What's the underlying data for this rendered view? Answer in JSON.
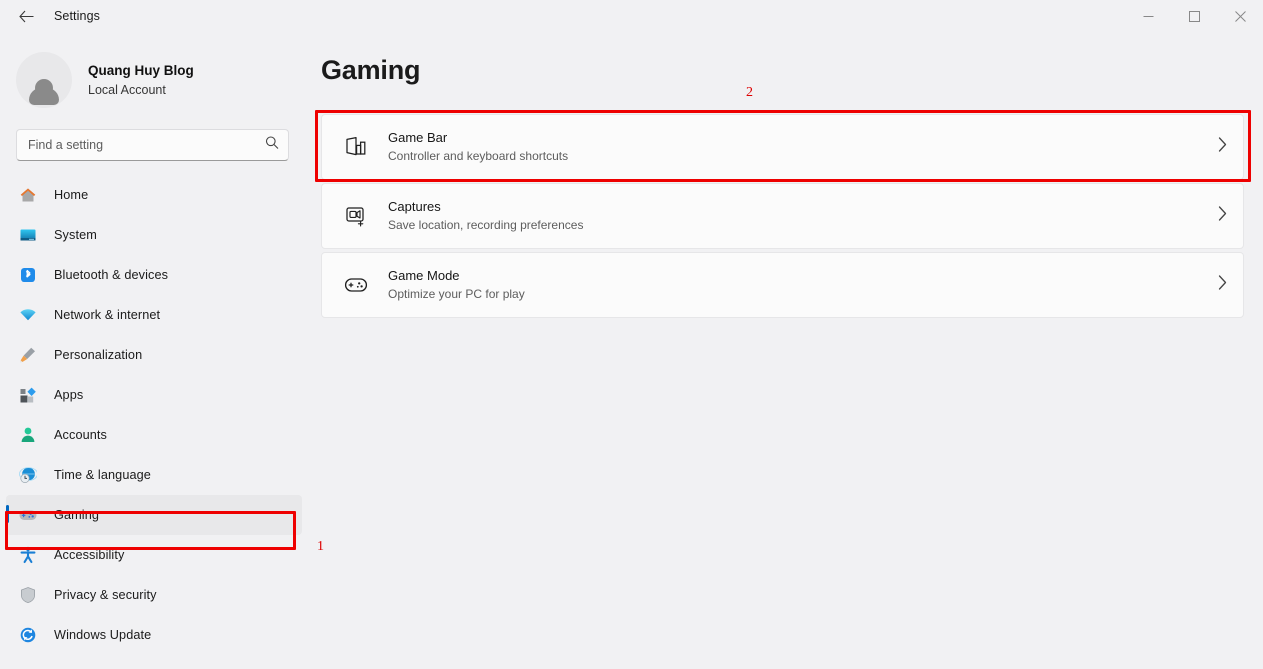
{
  "window": {
    "app_title": "Settings",
    "back_icon": "back-arrow-icon",
    "controls": {
      "minimize": "minimize-icon",
      "maximize": "maximize-icon",
      "close": "close-icon"
    }
  },
  "account": {
    "name": "Quang Huy Blog",
    "type": "Local Account",
    "avatar_icon": "person-avatar-icon"
  },
  "search": {
    "placeholder": "Find a setting",
    "icon": "search-icon"
  },
  "sidebar": {
    "items": [
      {
        "label": "Home",
        "icon": "home-icon",
        "selected": false
      },
      {
        "label": "System",
        "icon": "system-icon",
        "selected": false
      },
      {
        "label": "Bluetooth & devices",
        "icon": "bluetooth-icon",
        "selected": false
      },
      {
        "label": "Network & internet",
        "icon": "network-icon",
        "selected": false
      },
      {
        "label": "Personalization",
        "icon": "personalization-icon",
        "selected": false
      },
      {
        "label": "Apps",
        "icon": "apps-icon",
        "selected": false
      },
      {
        "label": "Accounts",
        "icon": "accounts-icon",
        "selected": false
      },
      {
        "label": "Time & language",
        "icon": "time-language-icon",
        "selected": false
      },
      {
        "label": "Gaming",
        "icon": "gaming-icon",
        "selected": true
      },
      {
        "label": "Accessibility",
        "icon": "accessibility-icon",
        "selected": false
      },
      {
        "label": "Privacy & security",
        "icon": "privacy-icon",
        "selected": false
      },
      {
        "label": "Windows Update",
        "icon": "windows-update-icon",
        "selected": false
      }
    ]
  },
  "main": {
    "page_title": "Gaming",
    "cards": [
      {
        "title": "Game Bar",
        "subtitle": "Controller and keyboard shortcuts",
        "icon": "game-bar-icon",
        "chevron": "chevron-right-icon"
      },
      {
        "title": "Captures",
        "subtitle": "Save location, recording preferences",
        "icon": "captures-icon",
        "chevron": "chevron-right-icon"
      },
      {
        "title": "Game Mode",
        "subtitle": "Optimize your PC for play",
        "icon": "game-mode-icon",
        "chevron": "chevron-right-icon"
      }
    ]
  },
  "annotations": {
    "color": "#ee0000",
    "marks": [
      {
        "number": "1",
        "target": "sidebar-item-gaming"
      },
      {
        "number": "2",
        "target": "card-game-bar"
      }
    ]
  }
}
